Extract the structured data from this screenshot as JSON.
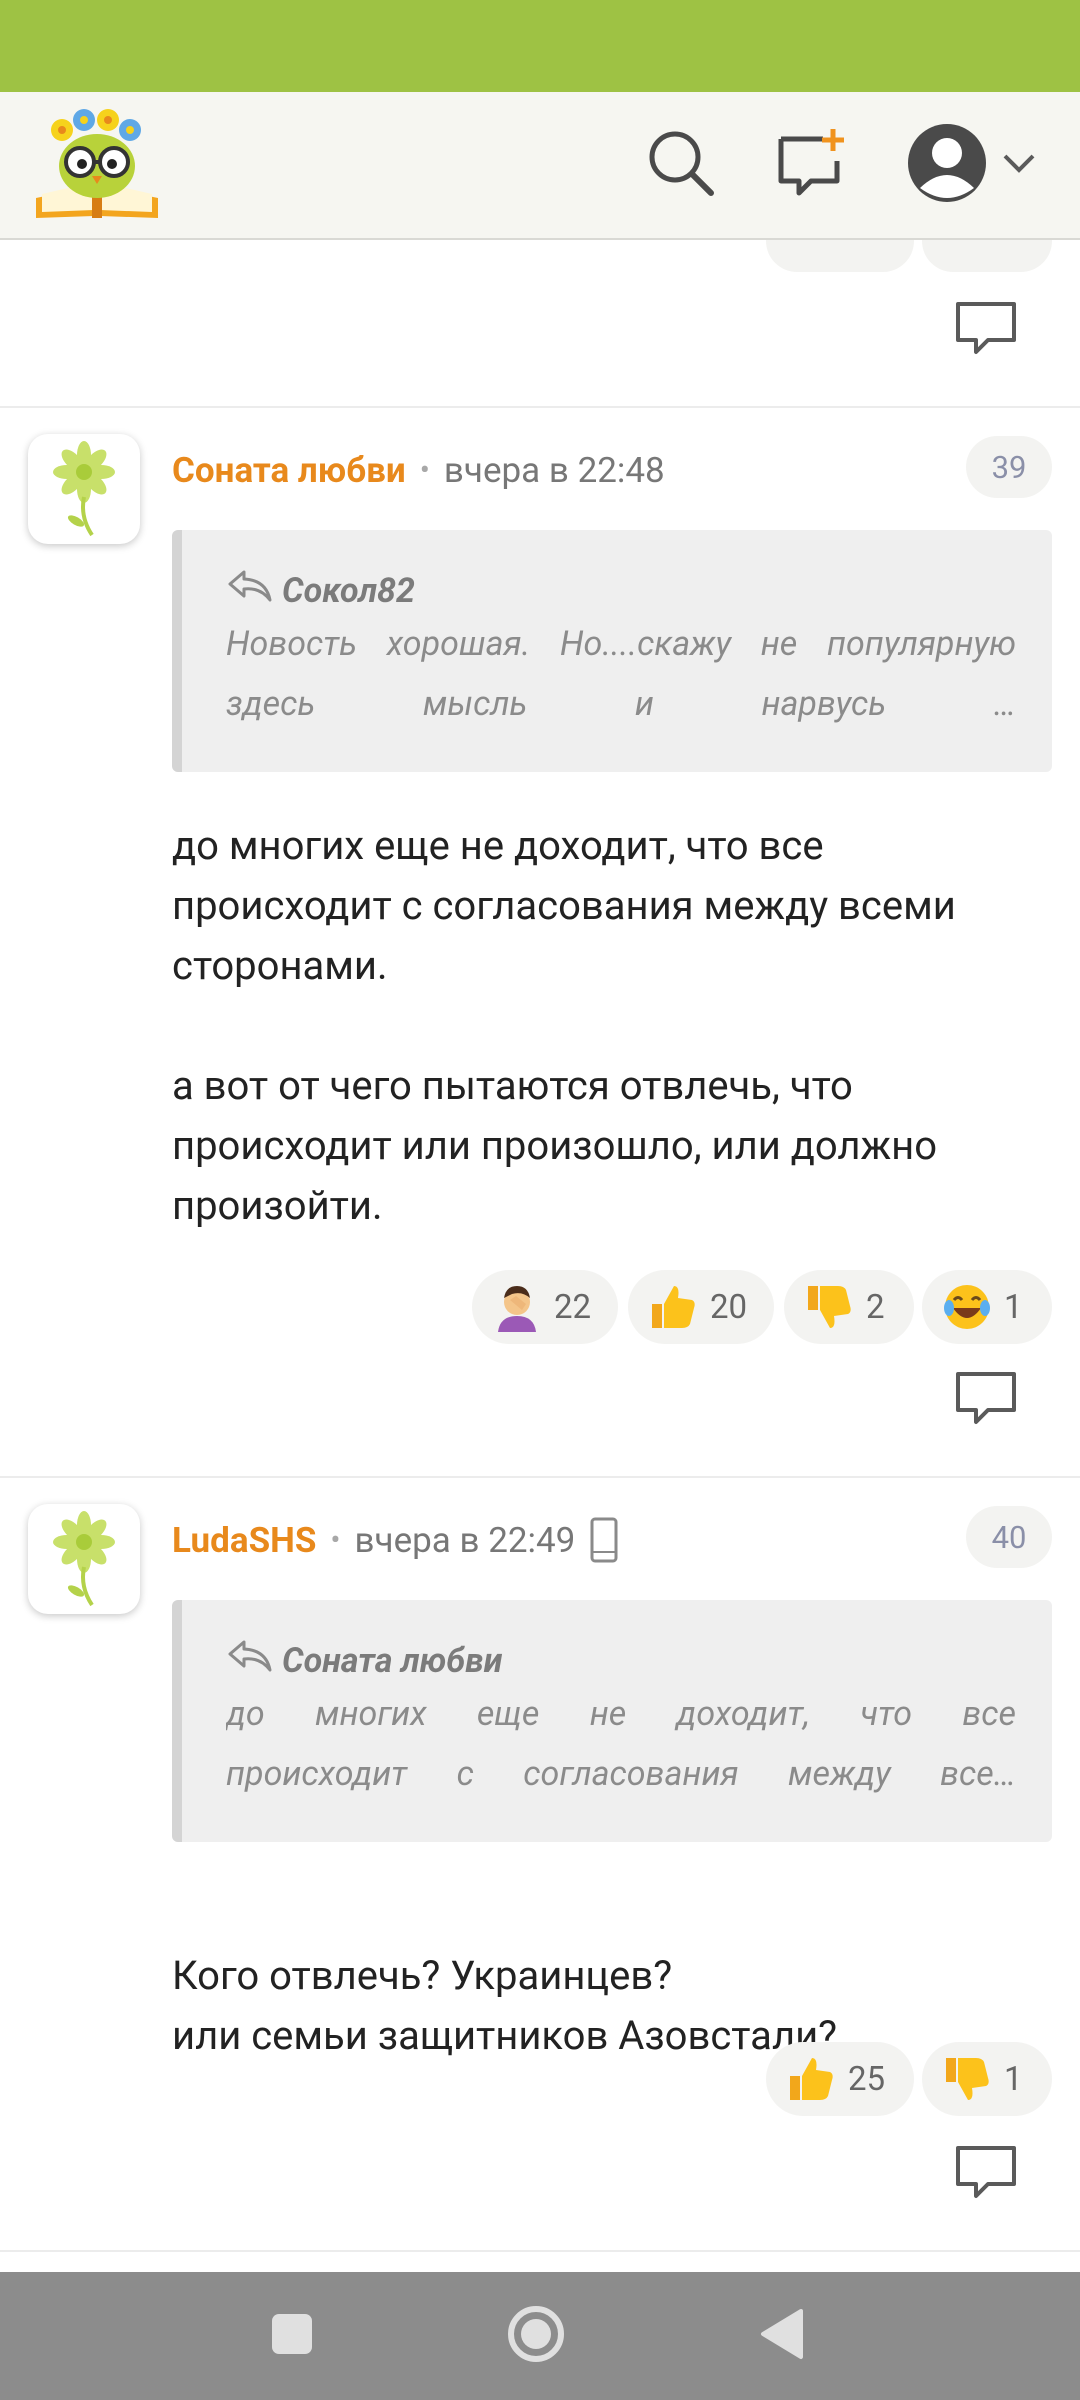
{
  "header": {
    "logo": "owl-on-book-logo",
    "icons": [
      "search-icon",
      "new-post-icon",
      "avatar-icon",
      "chevron-down-icon"
    ]
  },
  "comments": [
    {
      "author": "Соната любви",
      "time": "вчера в 22:48",
      "number": "39",
      "quote": {
        "author": "Сокол82",
        "lines": [
          "Новость хорошая. Но....скажу не популярную",
          "здесь мысль и нарвусь …"
        ]
      },
      "paragraphs": [
        "до многих еще не доходит, что все происходит с согласования между всеми сторонами.",
        "а вот от чего пытаются отвлечь, что происходит или произошло, или должно произойти."
      ],
      "reactions": [
        {
          "icon": "facepalm-emoji",
          "count": "22"
        },
        {
          "icon": "thumbs-up-emoji",
          "count": "20"
        },
        {
          "icon": "thumbs-down-emoji",
          "count": "2"
        },
        {
          "icon": "laughing-emoji",
          "count": "1"
        }
      ]
    },
    {
      "author": "LudaSHS",
      "time": "вчера в 22:49",
      "number": "40",
      "quote": {
        "author": "Соната любви",
        "lines": [
          "до многих еще не доходит, что все",
          "происходит с согласования между все…"
        ]
      },
      "paragraphs": [
        "Кого отвлечь? Украинцев?\nили семьи защитников Азовстали?"
      ],
      "reactions": [
        {
          "icon": "thumbs-up-emoji",
          "count": "25"
        },
        {
          "icon": "thumbs-down-emoji",
          "count": "1"
        }
      ]
    }
  ],
  "navigation": [
    "recent-apps-icon",
    "home-icon",
    "back-icon"
  ],
  "colors": {
    "status_bar": "#9ec244",
    "author": "#e8891c",
    "nav_bar": "#8c8c8c"
  }
}
